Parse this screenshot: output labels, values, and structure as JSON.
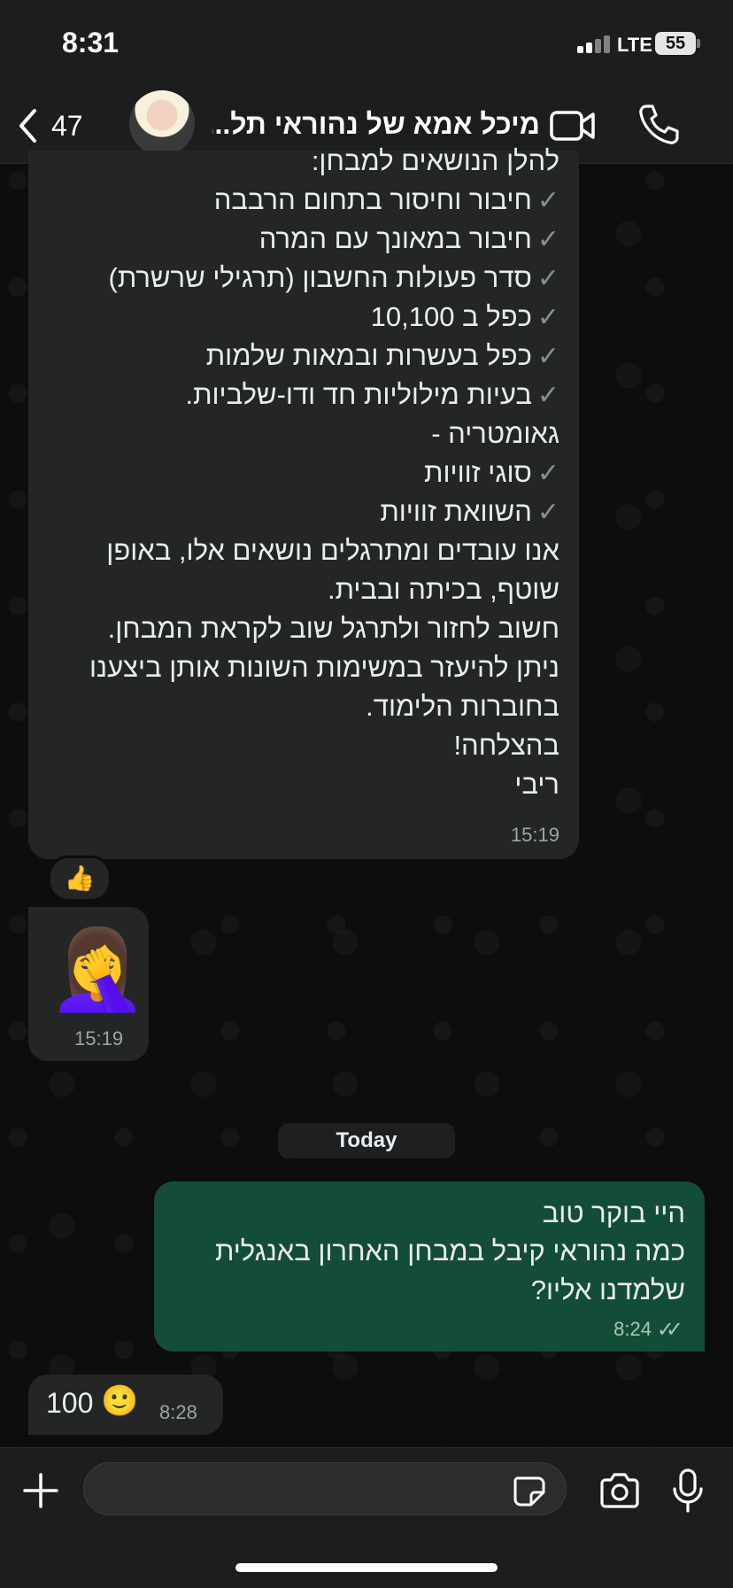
{
  "status_bar": {
    "time": "8:31",
    "network": "LTE",
    "battery": "55"
  },
  "header": {
    "back_count": "47",
    "contact_name": "מיכל אמא של נהוראי תל..."
  },
  "messages": {
    "teacher": {
      "lines": [
        "להלן הנושאים למבחן:",
        "חיבור וחיסור בתחום הרבבה",
        "חיבור במאונך עם המרה",
        "סדר פעולות החשבון (תרגילי שרשרת)",
        "כפל ב 10,100",
        "כפל בעשרות ובמאות שלמות",
        "בעיות מילוליות חד ודו-שלביות.",
        "גאומטריה -",
        "סוגי זוויות",
        "השוואת זוויות",
        "אנו עובדים ומתרגלים נושאים אלו, באופן",
        "שוטף, בכיתה ובבית.",
        "חשוב לחזור ולתרגל שוב לקראת המבחן.",
        "ניתן להיעזר במשימות השונות אותן ביצענו",
        "בחוברות הלימוד.",
        "בהצלחה!",
        "ריבי"
      ],
      "time": "15:19"
    },
    "reaction": "👍",
    "emoji_message": {
      "emoji": "🤦‍♀️",
      "time": "15:19"
    },
    "date_divider": "Today",
    "outgoing": {
      "text": "היי בוקר טוב\nכמה נהוראי קיבל במבחן האחרון באנגלית\nשלמדנו אליו?",
      "time": "8:24"
    },
    "reply": {
      "text": "100",
      "emoji": "🙂",
      "time": "8:28"
    }
  },
  "icons": [
    "back-chevron-icon",
    "video-call-icon",
    "phone-icon",
    "plus-icon",
    "sticker-icon",
    "camera-icon",
    "microphone-icon"
  ]
}
